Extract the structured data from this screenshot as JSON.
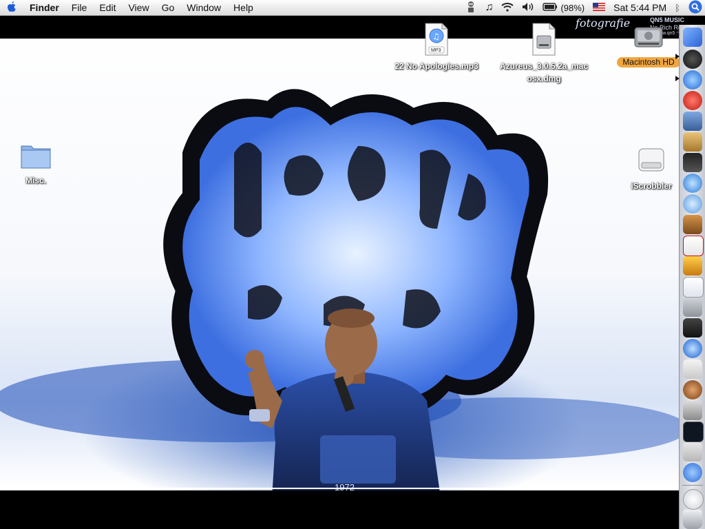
{
  "menubar": {
    "apple_icon": "apple-icon",
    "app_name": "Finder",
    "menus": [
      "File",
      "Edit",
      "View",
      "Go",
      "Window",
      "Help"
    ],
    "battery": "(98%)",
    "clock": "Sat 5:44 PM",
    "status_icons": [
      "robot-icon",
      "music-note-icon",
      "wifi-icon",
      "volume-icon",
      "battery-icon",
      "us-flag-icon",
      "bluetooth-icon",
      "spotlight-icon"
    ]
  },
  "wallpaper": {
    "brand_script": "fotografie",
    "brand_tagline": "No Rich Relatives.",
    "brand_url": "www.qn5.com",
    "brand_name": "QN5 MUSIC",
    "shirt_year": "1972"
  },
  "desktop_icons": {
    "mp3": {
      "label": "22 No Apologies.mp3",
      "badge": "MP3"
    },
    "dmg": {
      "label": "Azureus_3.0.5.2a_macosx.dmg",
      "line1": "Azureus_3.0.5.2a_mac",
      "line2": "osx.dmg"
    },
    "hd": {
      "label": "Macintosh HD"
    },
    "misc": {
      "label": "Misc."
    },
    "iscrobbler": {
      "label": "iScrobbler"
    }
  },
  "dock": {
    "items": [
      "finder-icon",
      "dashboard-icon",
      "safari-icon",
      "adium-icon",
      "mail-photo-icon",
      "address-book-icon",
      "imovie-icon",
      "itunes-icon",
      "itunes-store-icon",
      "garageband-icon",
      "ical-icon",
      "fruit-app-icon",
      "textedit-icon",
      "system-preferences-icon",
      "dvd-player-icon",
      "quicktime-icon",
      "ipod-icon",
      "coconut-battery-icon",
      "automator-icon",
      "activity-monitor-icon",
      "downloads-icon",
      "ichat-icon",
      "trash-icon"
    ],
    "active_arrows": [
      "finder-icon",
      "dashboard-icon",
      "safari-icon"
    ]
  },
  "colors": {
    "selection": "#f0a640",
    "accent": "#3b6fd8",
    "dock": "#dcdee3"
  }
}
